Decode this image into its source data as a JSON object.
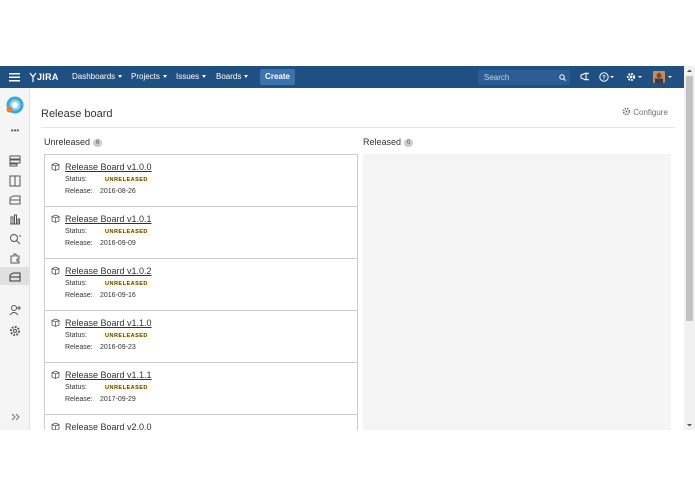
{
  "topbar": {
    "logo_text": "JIRA",
    "nav": [
      "Dashboards",
      "Projects",
      "Issues",
      "Boards"
    ],
    "create_label": "Create",
    "search_placeholder": "Search"
  },
  "sidebar": {
    "icons": [
      "project-avatar",
      "more-icon",
      "backlog-icon",
      "board-icon",
      "releases-icon",
      "reports-icon",
      "issues-icon",
      "components-icon",
      "release-board-icon",
      "add-people-icon",
      "settings-icon",
      "expand-icon"
    ],
    "more_label": "•••"
  },
  "page": {
    "title": "Release board",
    "configure_label": "Configure"
  },
  "columns": {
    "unreleased": {
      "label": "Unreleased",
      "count": "6"
    },
    "released": {
      "label": "Released",
      "count": "0"
    }
  },
  "cards": [
    {
      "name": "Release Board v1.0.0",
      "status_label": "Status:",
      "status": "UNRELEASED",
      "release_label": "Release:",
      "date": "2016-08-26"
    },
    {
      "name": "Release Board v1.0.1",
      "status_label": "Status:",
      "status": "UNRELEASED",
      "release_label": "Release:",
      "date": "2016-09-09"
    },
    {
      "name": "Release Board v1.0.2",
      "status_label": "Status:",
      "status": "UNRELEASED",
      "release_label": "Release:",
      "date": "2016-09-16"
    },
    {
      "name": "Release Board v1.1.0",
      "status_label": "Status:",
      "status": "UNRELEASED",
      "release_label": "Release:",
      "date": "2016-09-23"
    },
    {
      "name": "Release Board v1.1.1",
      "status_label": "Status:",
      "status": "UNRELEASED",
      "release_label": "Release:",
      "date": "2017-09-29"
    },
    {
      "name": "Release Board v2.0.0"
    }
  ],
  "colors": {
    "topbar": "#205081",
    "create_button": "#3b73af",
    "badge_bg": "#fffbe6",
    "badge_text": "#594300"
  }
}
